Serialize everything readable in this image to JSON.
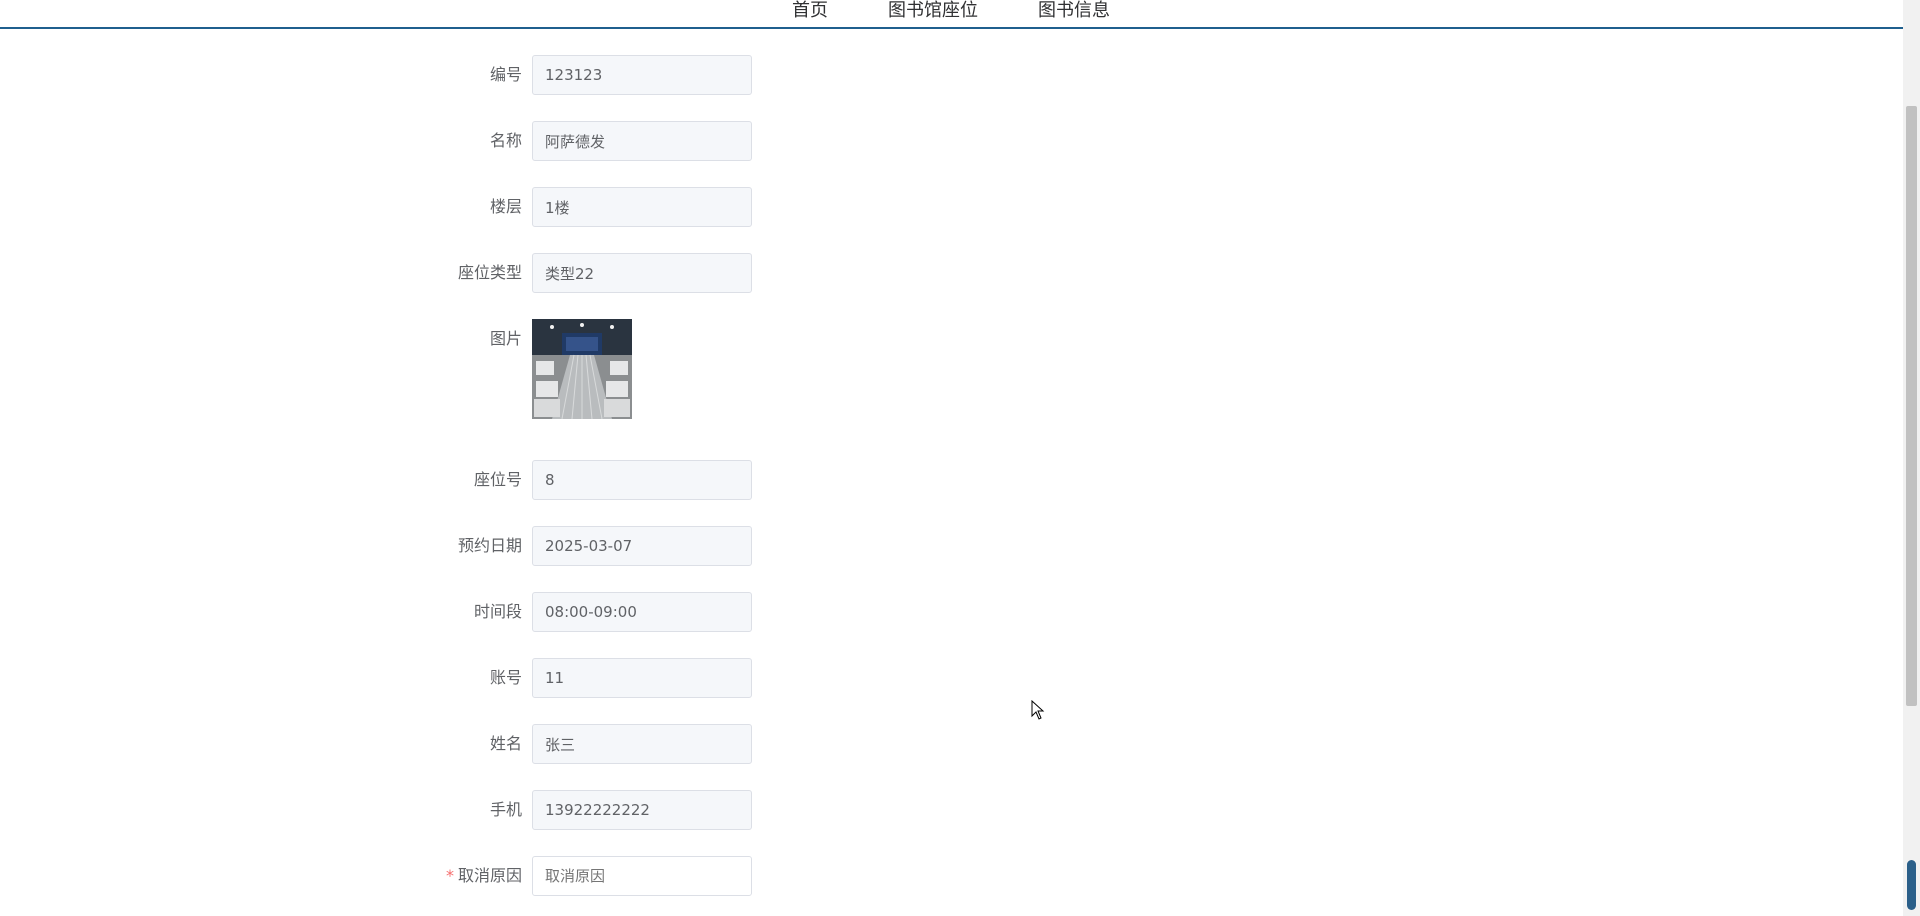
{
  "nav": {
    "items": [
      "首页",
      "图书馆座位",
      "图书信息"
    ]
  },
  "form": {
    "fields": [
      {
        "label": "编号",
        "value": "123123"
      },
      {
        "label": "名称",
        "value": "阿萨德发"
      },
      {
        "label": "楼层",
        "value": "1楼"
      },
      {
        "label": "座位类型",
        "value": "类型22"
      },
      {
        "label": "图片",
        "value": ""
      },
      {
        "label": "座位号",
        "value": "8"
      },
      {
        "label": "预约日期",
        "value": "2025-03-07"
      },
      {
        "label": "时间段",
        "value": "08:00-09:00"
      },
      {
        "label": "账号",
        "value": "11"
      },
      {
        "label": "姓名",
        "value": "张三"
      },
      {
        "label": "手机",
        "value": "13922222222"
      }
    ],
    "cancel_reason": {
      "required_mark": "*",
      "label": "取消原因",
      "placeholder": "取消原因"
    }
  },
  "colors": {
    "nav_border": "#1f5f8e",
    "required": "#f56c6c",
    "input_bg": "#f5f7fa",
    "input_border": "#dcdfe6"
  }
}
